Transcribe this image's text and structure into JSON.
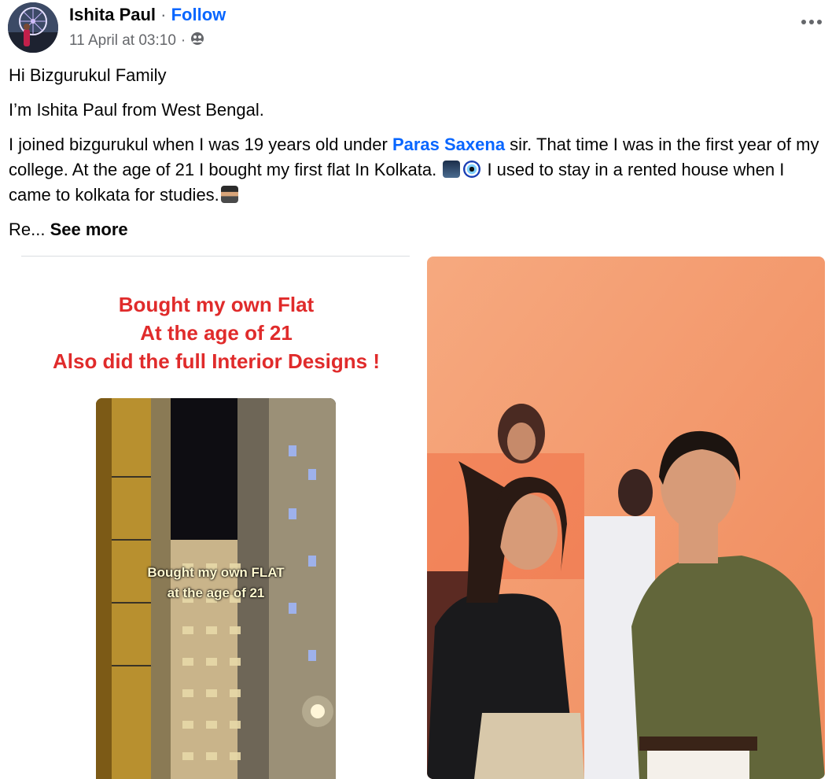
{
  "post": {
    "author": "Ishita Paul",
    "separator": " · ",
    "follow_label": "Follow",
    "timestamp": "11 April at 03:10",
    "meta_separator": "·",
    "audience_icon": "friends-icon",
    "more_icon": "more-options-icon"
  },
  "body": {
    "line1": "Hi Bizgurukul Family",
    "line2": "I’m Ishita Paul from West Bengal.",
    "p3_part1": "I joined bizgurukul when I was 19 years old under ",
    "mention": "Paras Saxena",
    "p3_part2": " sir. That time I was in the first year of my college. At the age of 21 I bought my first flat In Kolkata. ",
    "p3_part3": " I used to stay in a rented house when I came to kolkata for studies.",
    "truncated": "Re... ",
    "see_more": "See more",
    "emojis": [
      "cityscape-emoji",
      "nazar-amulet-emoji",
      "graduate-emoji"
    ]
  },
  "media": {
    "left": {
      "title_line1": "Bought my own Flat",
      "title_line2": "At the age of 21",
      "title_line3": "Also did the full Interior Designs !",
      "overlay_line1": "Bought my own FLAT",
      "overlay_line2": "at the age of 21",
      "title_color": "#e02b2b"
    },
    "right": {
      "description_icon": "event-photo",
      "background_color": "#f4a27c"
    }
  },
  "colors": {
    "link": "#0866ff",
    "secondary_text": "#65676b",
    "text": "#050505"
  }
}
